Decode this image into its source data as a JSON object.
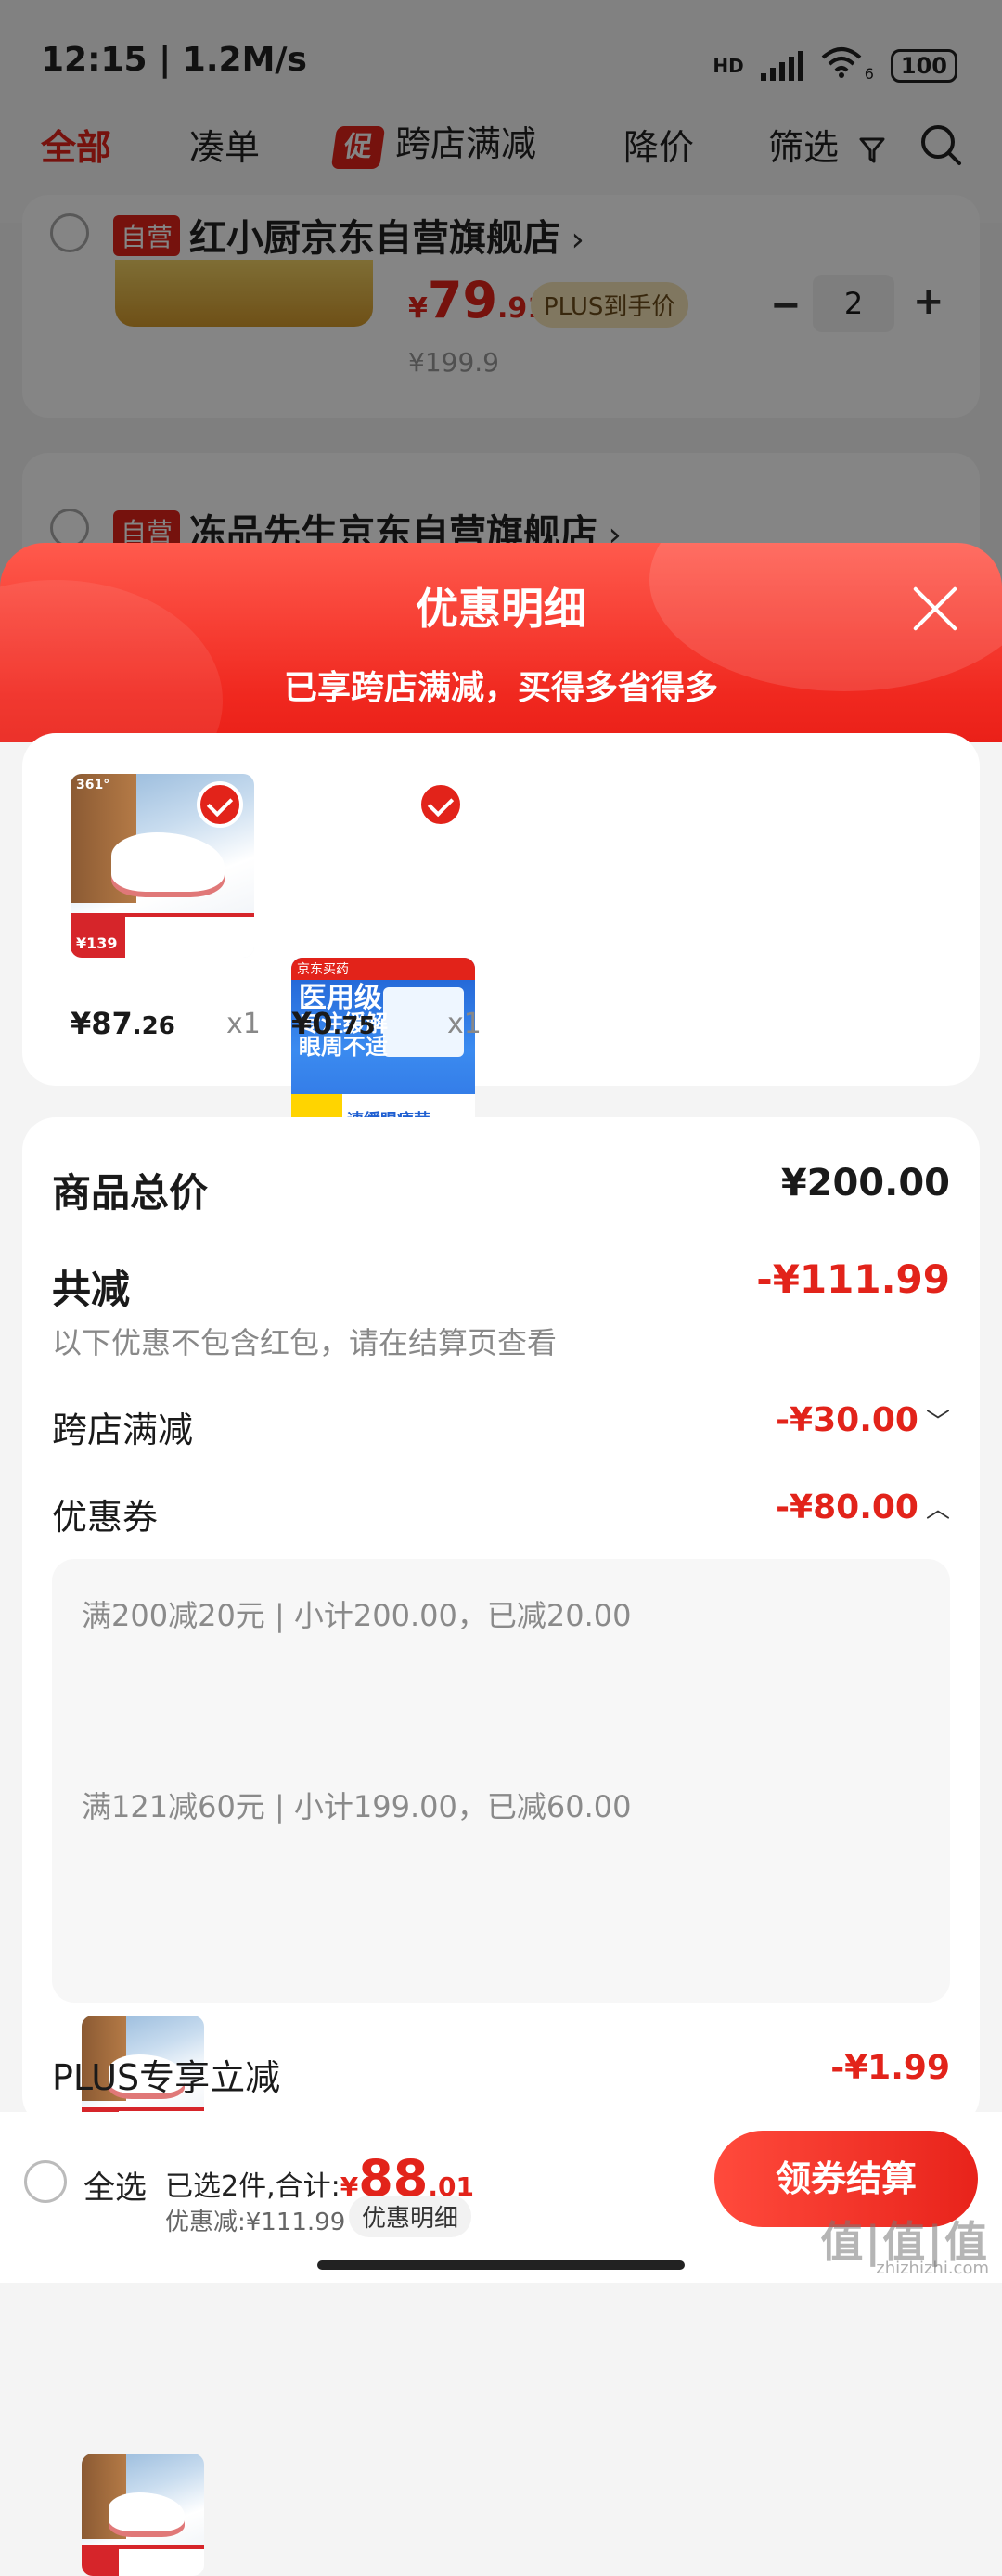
{
  "status_bar": {
    "time": "12:15 | 1.2M/s",
    "network": "HD",
    "wifi_label": "6",
    "battery": "100"
  },
  "filter_bar": {
    "tabs": [
      {
        "label": "全部",
        "active": true
      },
      {
        "label": "凑单"
      },
      {
        "tag": "促",
        "label": "跨店满减"
      },
      {
        "label": "降价"
      },
      {
        "label": "筛选"
      }
    ]
  },
  "cart": {
    "shop1": {
      "tag": "自营",
      "name": "红小厨京东自营旗舰店",
      "price_symbol": "¥",
      "price_int": "79",
      "price_dec": ".91",
      "plus_label": "PLUS到手价",
      "original_price": "¥199.9",
      "qty": "2"
    },
    "shop2": {
      "tag": "自营",
      "name": "冻品先生京东自营旗舰店"
    }
  },
  "sheet": {
    "title": "优惠明细",
    "subtitle": "已享跨店满减，买得多省得多",
    "items": [
      {
        "price_int": "¥87",
        "price_dec": ".26",
        "qty": "x1",
        "image": "sneaker",
        "img_brand": "361°",
        "img_price": "¥139"
      },
      {
        "price_int": "¥0",
        "price_dec": ".75",
        "qty": "x1",
        "image": "eye-patch",
        "img_top": "京东买药",
        "img_text": [
          "医用级",
          "专注缓解",
          "眼周不适"
        ],
        "img_bottom": "速缓眼疲劳"
      }
    ],
    "summary": {
      "total_label": "商品总价",
      "total_value": "¥200.00",
      "reduce_label": "共减",
      "reduce_value": "-¥111.99",
      "reduce_note": "以下优惠不包含红包，请在结算页查看",
      "rows": [
        {
          "label": "跨店满减",
          "value": "-¥30.00",
          "chevron": "﹀"
        },
        {
          "label": "优惠券",
          "value": "-¥80.00",
          "chevron": "︿"
        }
      ],
      "coupons": [
        {
          "text": "满200减20元 | 小计200.00，已减20.00"
        },
        {
          "text": "满121减60元 | 小计199.00，已减60.00"
        }
      ],
      "plus_label": "PLUS专享立减",
      "plus_value": "-¥1.99"
    }
  },
  "bottom_bar": {
    "select_all": "全选",
    "selected_text": "已选2件,合计:",
    "total_symbol": "¥",
    "total_int": "88",
    "total_dec": ".01",
    "discount_text": "优惠减:¥111.99",
    "detail_btn": "优惠明细",
    "checkout_btn": "领券结算"
  },
  "watermark": {
    "main": "值|值|值",
    "sub": "zhizhizhi.com"
  }
}
